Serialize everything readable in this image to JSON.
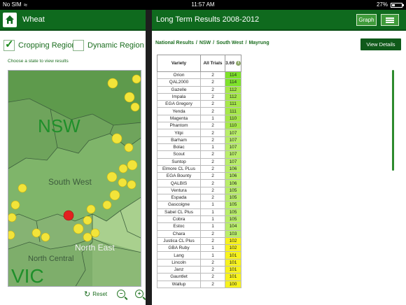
{
  "status_bar": {
    "carrier": "No SIM",
    "time": "11:57 AM",
    "battery": "27%"
  },
  "left": {
    "title": "Wheat",
    "cropping_label": "Cropping Region",
    "cropping_checked": true,
    "dynamic_label": "Dynamic Region",
    "dynamic_checked": false,
    "map_hint": "Choose a state to view results",
    "map_labels": [
      "NSW",
      "South West",
      "North East",
      "North Central",
      "VIC"
    ],
    "reset_label": "Reset"
  },
  "right": {
    "title": "Long Term Results 2008-2012",
    "graph_label": "Graph",
    "breadcrumb": [
      "National Results",
      "NSW",
      "South West",
      "Mayrung"
    ],
    "view_details_label": "View Details",
    "table": {
      "headers": [
        "Variety",
        "All Trials",
        "3.69"
      ],
      "rows": [
        [
          "Orion",
          "2",
          "114"
        ],
        [
          "QAL2000",
          "2",
          "114"
        ],
        [
          "Gazelle",
          "2",
          "112"
        ],
        [
          "Impala",
          "2",
          "112"
        ],
        [
          "EGA Gregory",
          "2",
          "111"
        ],
        [
          "Yenda",
          "2",
          "111"
        ],
        [
          "Magenta",
          "1",
          "110"
        ],
        [
          "Phantom",
          "2",
          "110"
        ],
        [
          "Yitpi",
          "2",
          "107"
        ],
        [
          "Barham",
          "2",
          "107"
        ],
        [
          "Bolac",
          "1",
          "107"
        ],
        [
          "Scout",
          "2",
          "107"
        ],
        [
          "Suntop",
          "2",
          "107"
        ],
        [
          "Elmore CL PLus",
          "2",
          "106"
        ],
        [
          "EGA Bounty",
          "2",
          "106"
        ],
        [
          "QALBIS",
          "2",
          "106"
        ],
        [
          "Ventura",
          "2",
          "105"
        ],
        [
          "Espada",
          "2",
          "105"
        ],
        [
          "Gascoigne",
          "1",
          "105"
        ],
        [
          "Sabel CL Plus",
          "1",
          "105"
        ],
        [
          "Cobra",
          "1",
          "105"
        ],
        [
          "Estoc",
          "1",
          "104"
        ],
        [
          "Chara",
          "2",
          "103"
        ],
        [
          "Justica CL Plus",
          "2",
          "102"
        ],
        [
          "GBA Ruby",
          "1",
          "102"
        ],
        [
          "Lang",
          "1",
          "101"
        ],
        [
          "Lincoln",
          "2",
          "101"
        ],
        [
          "Janz",
          "2",
          "101"
        ],
        [
          "Gauntlet",
          "2",
          "101"
        ],
        [
          "Wallup",
          "2",
          "100"
        ]
      ],
      "score_colors": [
        "#7ee22a",
        "#7ee22a",
        "#a6e84a",
        "#a6e84a",
        "#a6e84a",
        "#a6e84a",
        "#a6e84a",
        "#a6e84a",
        "#b9ee6a",
        "#b9ee6a",
        "#b9ee6a",
        "#b9ee6a",
        "#b9ee6a",
        "#b9ee6a",
        "#b9ee6a",
        "#b9ee6a",
        "#b9ee6a",
        "#b9ee6a",
        "#b9ee6a",
        "#b9ee6a",
        "#b9ee6a",
        "#b9ee6a",
        "#b9ee6a",
        "#f7f21e",
        "#f7f21e",
        "#f7f21e",
        "#f7f21e",
        "#f7f21e",
        "#f7f21e",
        "#f7f21e"
      ]
    }
  },
  "colors": {
    "header_green": "#0f6a1e",
    "text_green": "#1b6d1f",
    "map_green": "#6fa45c"
  }
}
